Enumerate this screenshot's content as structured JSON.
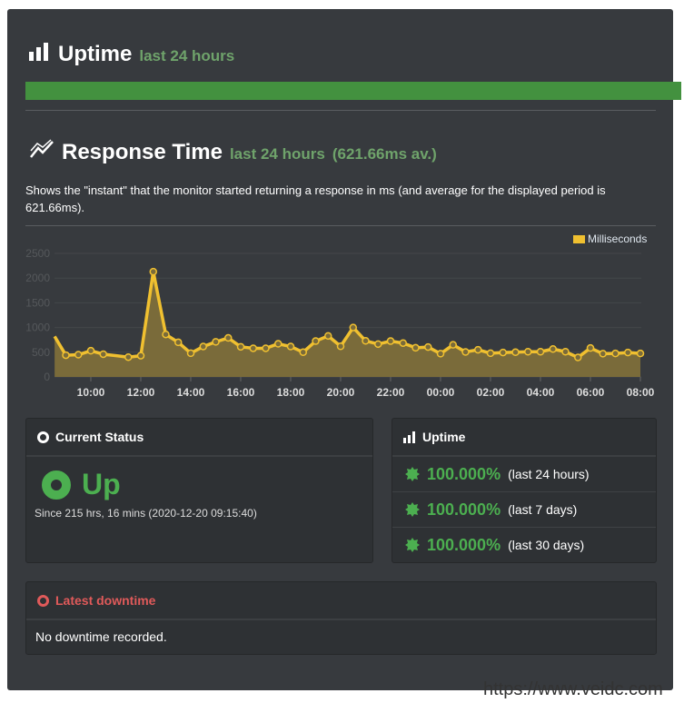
{
  "uptime_header": {
    "title": "Uptime",
    "subtitle": "last 24 hours",
    "bar_percent": 100,
    "bar_color": "#43913f"
  },
  "response_header": {
    "title": "Response Time",
    "subtitle": "last 24 hours",
    "average": "(621.66ms av.)"
  },
  "description": "Shows the \"instant\" that the monitor started returning a response in ms (and average for the displayed period is 621.66ms).",
  "chart_data": {
    "type": "area",
    "legend": "Milliseconds",
    "legend_position": "top-right",
    "color": "#f0c030",
    "ylim": [
      0,
      2500
    ],
    "yticks": [
      "0",
      "500",
      "1000",
      "1500",
      "2000",
      "2500"
    ],
    "xticks": [
      "10:00",
      "12:00",
      "14:00",
      "16:00",
      "18:00",
      "20:00",
      "22:00",
      "00:00",
      "02:00",
      "04:00",
      "06:00",
      "08:00"
    ],
    "x": [
      "08:33",
      "09:00",
      "09:30",
      "10:00",
      "10:30",
      "11:30",
      "12:00",
      "12:30",
      "13:00",
      "13:30",
      "14:00",
      "14:30",
      "15:00",
      "15:30",
      "16:00",
      "16:30",
      "17:00",
      "17:30",
      "18:00",
      "18:30",
      "19:00",
      "19:30",
      "20:00",
      "20:30",
      "21:00",
      "21:30",
      "22:00",
      "22:30",
      "23:00",
      "23:30",
      "00:00",
      "00:30",
      "01:00",
      "01:30",
      "02:00",
      "02:30",
      "03:00",
      "03:30",
      "04:00",
      "04:30",
      "05:00",
      "05:30",
      "06:00",
      "06:30",
      "07:00",
      "07:30",
      "08:00"
    ],
    "values": [
      820,
      440,
      450,
      530,
      460,
      400,
      430,
      2130,
      860,
      700,
      480,
      615,
      710,
      790,
      610,
      580,
      580,
      670,
      615,
      500,
      725,
      830,
      620,
      1000,
      730,
      665,
      725,
      685,
      590,
      605,
      470,
      650,
      505,
      550,
      480,
      495,
      500,
      510,
      510,
      565,
      510,
      395,
      585,
      470,
      475,
      495,
      475
    ]
  },
  "current_status": {
    "title": "Current Status",
    "state": "Up",
    "since": "Since 215 hrs, 16 mins (2020-12-20 09:15:40)"
  },
  "uptime_panel": {
    "title": "Uptime",
    "rows": [
      {
        "pct": "100.000%",
        "label": "(last 24 hours)"
      },
      {
        "pct": "100.000%",
        "label": "(last 7 days)"
      },
      {
        "pct": "100.000%",
        "label": "(last 30 days)"
      }
    ]
  },
  "downtime": {
    "title": "Latest downtime",
    "text": "No downtime recorded."
  },
  "watermark": "https://www.veidc.com"
}
